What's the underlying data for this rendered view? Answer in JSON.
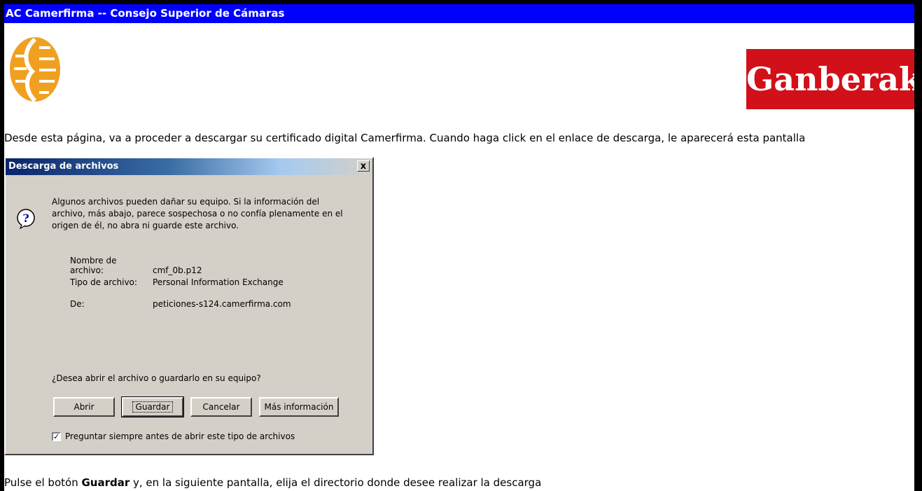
{
  "window": {
    "title": "AC Camerfirma -- Consejo Superior de Cámaras"
  },
  "brand": {
    "right_logo_text": "Ganberak"
  },
  "intro_text": "Desde esta página, va a proceder a descargar su certificado digital Camerfirma. Cuando haga click en el enlace de descarga, le aparecerá esta pantalla",
  "dialog": {
    "title": "Descarga de archivos",
    "close_label": "x",
    "warning": "Algunos archivos pueden dañar su equipo. Si la información del archivo, más abajo, parece sospechosa o no confía plenamente en el origen de él, no abra ni guarde este archivo.",
    "file_name_label": "Nombre de archivo:",
    "file_name": "cmf_0b.p12",
    "file_type_label": "Tipo de archivo:",
    "file_type": "Personal Information Exchange",
    "from_label": "De:",
    "from": "peticiones-s124.camerfirma.com",
    "question": "¿Desea abrir el archivo o guardarlo en su equipo?",
    "buttons": {
      "open": "Abrir",
      "save": "Guardar",
      "cancel": "Cancelar",
      "more_info": "Más información"
    },
    "checkbox_label": "Preguntar siempre antes de abrir este tipo de archivos",
    "checkbox_checked": true
  },
  "footer": {
    "prefix": "Pulse el botón ",
    "bold": "Guardar",
    "suffix": " y, en la siguiente pantalla, elija el directorio donde desee realizar la descarga"
  }
}
